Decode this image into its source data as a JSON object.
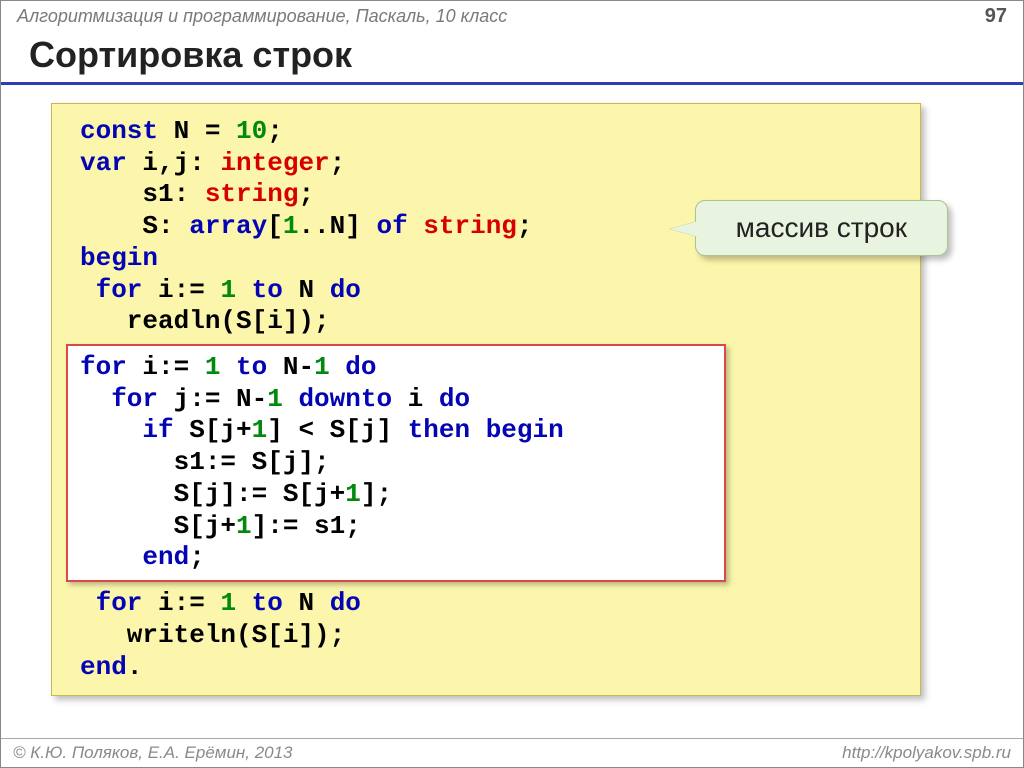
{
  "header": {
    "breadcrumb": "Алгоритмизация и программирование, Паскаль, 10 класс",
    "page": "97"
  },
  "title": "Сортировка строк",
  "callout": "массив строк",
  "code": {
    "kw_const": "const",
    "t_N": " N = ",
    "n_10": "10",
    "t_semi": ";",
    "kw_var": "var",
    "t_ij": " i,j: ",
    "ty_int": "integer",
    "t_s1decl": "    s1: ",
    "ty_str1": "string",
    "t_Sdecl": "    S: ",
    "kw_array": "array",
    "t_br1": "[",
    "n_1a": "1",
    "t_range": "..N] ",
    "kw_of": "of",
    "t_sp": " ",
    "ty_str2": "string",
    "kw_begin": "begin",
    "kw_for1": " for",
    "t_iass": " i:= ",
    "n_1b": "1",
    "t_sp2": " ",
    "kw_to1": "to",
    "t_Ndo": " N ",
    "kw_do1": "do",
    "t_readln": "   readln(S[i]);",
    "kw_for2": "for",
    "t_iass2": " i:= ",
    "n_1c": "1",
    "t_sp3": " ",
    "kw_to2": "to",
    "t_Nm1": " N-",
    "n_1d": "1",
    "t_sp4": " ",
    "kw_do2": "do",
    "kw_for3": "  for",
    "t_jass": " j:= N-",
    "n_1e": "1",
    "t_sp5": " ",
    "kw_downto": "downto",
    "t_ido": " i ",
    "kw_do3": "do",
    "kw_if": "    if",
    "t_cond1": " S[j+",
    "n_1f": "1",
    "t_cond2": "] < S[j] ",
    "kw_then": "then begin",
    "t_swap1": "      s1:= S[j];",
    "t_swap2a": "      S[j]:= S[j+",
    "n_1g": "1",
    "t_swap2b": "];",
    "t_swap3a": "      S[j+",
    "n_1h": "1",
    "t_swap3b": "]:= s1;",
    "kw_end1": "    end",
    "t_semiend": ";",
    "kw_for4": " for",
    "t_iass3": " i:= ",
    "n_1i": "1",
    "t_sp6": " ",
    "kw_to3": "to",
    "t_Ndo2": " N ",
    "kw_do4": "do",
    "t_writeln": "   writeln(S[i]);",
    "kw_end2": "end",
    "t_dot": "."
  },
  "footer": {
    "left": "© К.Ю. Поляков, Е.А. Ерёмин, 2013",
    "right": "http://kpolyakov.spb.ru"
  }
}
